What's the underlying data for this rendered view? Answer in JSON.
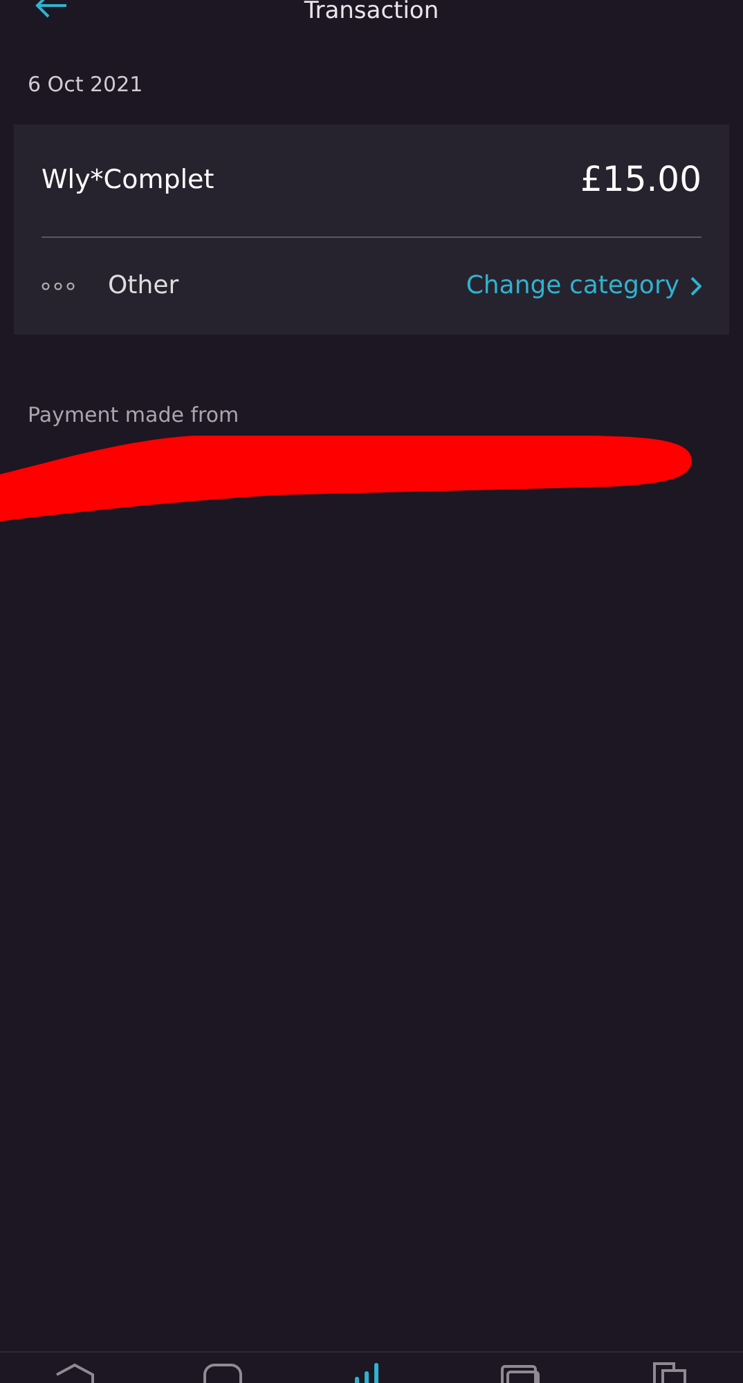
{
  "header": {
    "title": "Transaction"
  },
  "date": "6 Oct 2021",
  "transaction": {
    "merchant": "Wly*Complet",
    "amount": "£15.00",
    "category": "Other",
    "change_link": "Change category"
  },
  "payment_source": {
    "label": "Payment made from",
    "redacted": true
  },
  "nav_tabs": [
    {
      "kind": "home",
      "selected": false
    },
    {
      "kind": "chat",
      "selected": false
    },
    {
      "kind": "insights",
      "selected": true
    },
    {
      "kind": "cards",
      "selected": false
    },
    {
      "kind": "documents",
      "selected": false
    }
  ]
}
